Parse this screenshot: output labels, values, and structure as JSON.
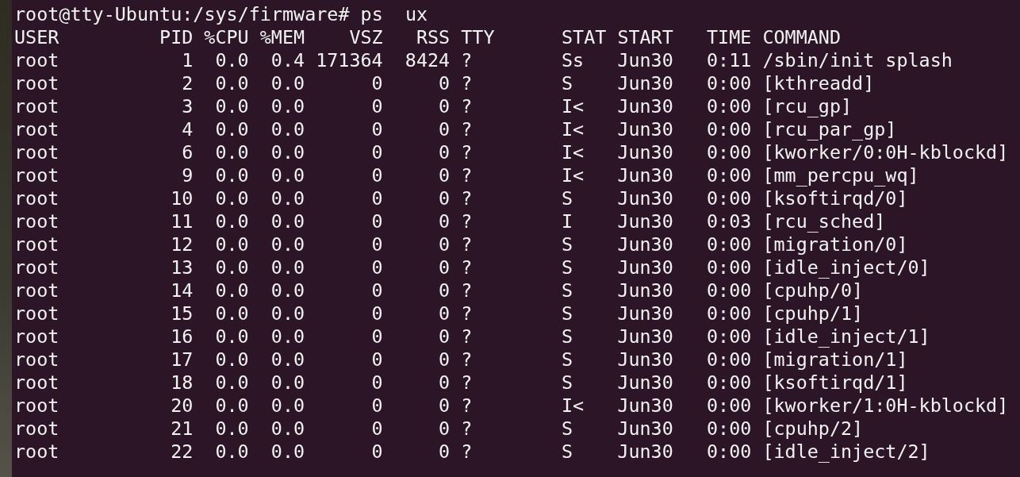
{
  "terminal": {
    "prompt": "root@tty-Ubuntu:/sys/firmware# ps  ux",
    "table": {
      "columns": [
        "USER",
        "PID",
        "%CPU",
        "%MEM",
        "VSZ",
        "RSS",
        "TTY",
        "STAT",
        "START",
        "TIME",
        "COMMAND"
      ],
      "rows": [
        [
          "root",
          "1",
          "0.0",
          "0.4",
          "171364",
          "8424",
          "?",
          "Ss",
          "Jun30",
          "0:11",
          "/sbin/init splash"
        ],
        [
          "root",
          "2",
          "0.0",
          "0.0",
          "0",
          "0",
          "?",
          "S",
          "Jun30",
          "0:00",
          "[kthreadd]"
        ],
        [
          "root",
          "3",
          "0.0",
          "0.0",
          "0",
          "0",
          "?",
          "I<",
          "Jun30",
          "0:00",
          "[rcu_gp]"
        ],
        [
          "root",
          "4",
          "0.0",
          "0.0",
          "0",
          "0",
          "?",
          "I<",
          "Jun30",
          "0:00",
          "[rcu_par_gp]"
        ],
        [
          "root",
          "6",
          "0.0",
          "0.0",
          "0",
          "0",
          "?",
          "I<",
          "Jun30",
          "0:00",
          "[kworker/0:0H-kblockd]"
        ],
        [
          "root",
          "9",
          "0.0",
          "0.0",
          "0",
          "0",
          "?",
          "I<",
          "Jun30",
          "0:00",
          "[mm_percpu_wq]"
        ],
        [
          "root",
          "10",
          "0.0",
          "0.0",
          "0",
          "0",
          "?",
          "S",
          "Jun30",
          "0:00",
          "[ksoftirqd/0]"
        ],
        [
          "root",
          "11",
          "0.0",
          "0.0",
          "0",
          "0",
          "?",
          "I",
          "Jun30",
          "0:03",
          "[rcu_sched]"
        ],
        [
          "root",
          "12",
          "0.0",
          "0.0",
          "0",
          "0",
          "?",
          "S",
          "Jun30",
          "0:00",
          "[migration/0]"
        ],
        [
          "root",
          "13",
          "0.0",
          "0.0",
          "0",
          "0",
          "?",
          "S",
          "Jun30",
          "0:00",
          "[idle_inject/0]"
        ],
        [
          "root",
          "14",
          "0.0",
          "0.0",
          "0",
          "0",
          "?",
          "S",
          "Jun30",
          "0:00",
          "[cpuhp/0]"
        ],
        [
          "root",
          "15",
          "0.0",
          "0.0",
          "0",
          "0",
          "?",
          "S",
          "Jun30",
          "0:00",
          "[cpuhp/1]"
        ],
        [
          "root",
          "16",
          "0.0",
          "0.0",
          "0",
          "0",
          "?",
          "S",
          "Jun30",
          "0:00",
          "[idle_inject/1]"
        ],
        [
          "root",
          "17",
          "0.0",
          "0.0",
          "0",
          "0",
          "?",
          "S",
          "Jun30",
          "0:00",
          "[migration/1]"
        ],
        [
          "root",
          "18",
          "0.0",
          "0.0",
          "0",
          "0",
          "?",
          "S",
          "Jun30",
          "0:00",
          "[ksoftirqd/1]"
        ],
        [
          "root",
          "20",
          "0.0",
          "0.0",
          "0",
          "0",
          "?",
          "I<",
          "Jun30",
          "0:00",
          "[kworker/1:0H-kblockd]"
        ],
        [
          "root",
          "21",
          "0.0",
          "0.0",
          "0",
          "0",
          "?",
          "S",
          "Jun30",
          "0:00",
          "[cpuhp/2]"
        ],
        [
          "root",
          "22",
          "0.0",
          "0.0",
          "0",
          "0",
          "?",
          "S",
          "Jun30",
          "0:00",
          "[idle_inject/2]"
        ]
      ]
    }
  }
}
